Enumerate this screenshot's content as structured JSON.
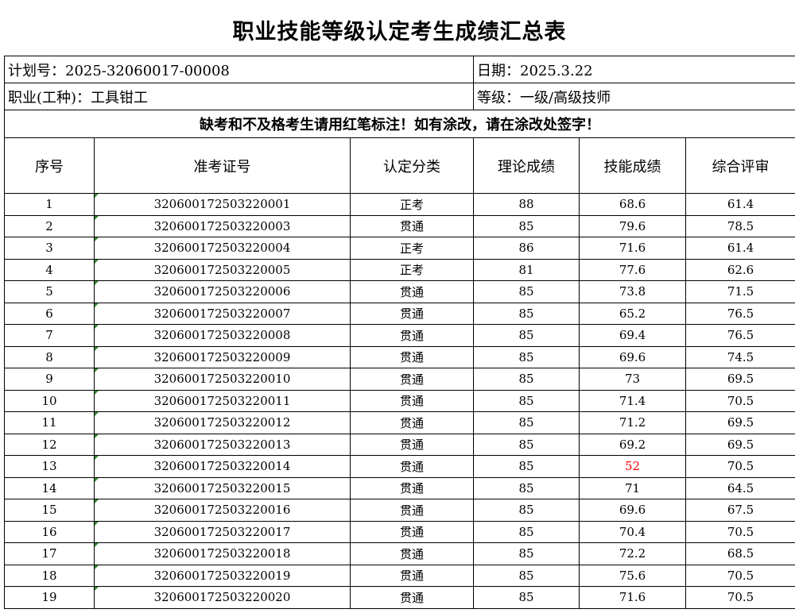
{
  "title": "职业技能等级认定考生成绩汇总表",
  "meta": {
    "plan_no": "计划号：2025-32060017-00008",
    "date": "日期：2025.3.22",
    "occupation": "职业(工种)：工具钳工",
    "level": "等级：一级/高级技师"
  },
  "notice": "缺考和不及格考生请用红笔标注！如有涂改，请在涂改处签字！",
  "headers": {
    "seq": "序号",
    "ticket": "准考证号",
    "category": "认定分类",
    "theory": "理论成绩",
    "skill": "技能成绩",
    "overall": "综合评审"
  },
  "fail_color": "#ff0000",
  "rows": [
    {
      "seq": "1",
      "ticket": "320600172503220001",
      "category": "正考",
      "theory": "88",
      "skill": "68.6",
      "overall": "61.4"
    },
    {
      "seq": "2",
      "ticket": "320600172503220003",
      "category": "贯通",
      "theory": "85",
      "skill": "79.6",
      "overall": "78.5"
    },
    {
      "seq": "3",
      "ticket": "320600172503220004",
      "category": "正考",
      "theory": "86",
      "skill": "71.6",
      "overall": "61.4"
    },
    {
      "seq": "4",
      "ticket": "320600172503220005",
      "category": "正考",
      "theory": "81",
      "skill": "77.6",
      "overall": "62.6"
    },
    {
      "seq": "5",
      "ticket": "320600172503220006",
      "category": "贯通",
      "theory": "85",
      "skill": "73.8",
      "overall": "71.5"
    },
    {
      "seq": "6",
      "ticket": "320600172503220007",
      "category": "贯通",
      "theory": "85",
      "skill": "65.2",
      "overall": "76.5"
    },
    {
      "seq": "7",
      "ticket": "320600172503220008",
      "category": "贯通",
      "theory": "85",
      "skill": "69.4",
      "overall": "76.5"
    },
    {
      "seq": "8",
      "ticket": "320600172503220009",
      "category": "贯通",
      "theory": "85",
      "skill": "69.6",
      "overall": "74.5"
    },
    {
      "seq": "9",
      "ticket": "320600172503220010",
      "category": "贯通",
      "theory": "85",
      "skill": "73",
      "overall": "69.5"
    },
    {
      "seq": "10",
      "ticket": "320600172503220011",
      "category": "贯通",
      "theory": "85",
      "skill": "71.4",
      "overall": "70.5"
    },
    {
      "seq": "11",
      "ticket": "320600172503220012",
      "category": "贯通",
      "theory": "85",
      "skill": "71.2",
      "overall": "69.5"
    },
    {
      "seq": "12",
      "ticket": "320600172503220013",
      "category": "贯通",
      "theory": "85",
      "skill": "69.2",
      "overall": "69.5"
    },
    {
      "seq": "13",
      "ticket": "320600172503220014",
      "category": "贯通",
      "theory": "85",
      "skill": "52",
      "overall": "70.5",
      "skill_fail": true
    },
    {
      "seq": "14",
      "ticket": "320600172503220015",
      "category": "贯通",
      "theory": "85",
      "skill": "71",
      "overall": "64.5"
    },
    {
      "seq": "15",
      "ticket": "320600172503220016",
      "category": "贯通",
      "theory": "85",
      "skill": "69.6",
      "overall": "67.5"
    },
    {
      "seq": "16",
      "ticket": "320600172503220017",
      "category": "贯通",
      "theory": "85",
      "skill": "70.4",
      "overall": "70.5"
    },
    {
      "seq": "17",
      "ticket": "320600172503220018",
      "category": "贯通",
      "theory": "85",
      "skill": "72.2",
      "overall": "68.5"
    },
    {
      "seq": "18",
      "ticket": "320600172503220019",
      "category": "贯通",
      "theory": "85",
      "skill": "75.6",
      "overall": "70.5"
    },
    {
      "seq": "19",
      "ticket": "320600172503220020",
      "category": "贯通",
      "theory": "85",
      "skill": "71.6",
      "overall": "70.5"
    }
  ]
}
